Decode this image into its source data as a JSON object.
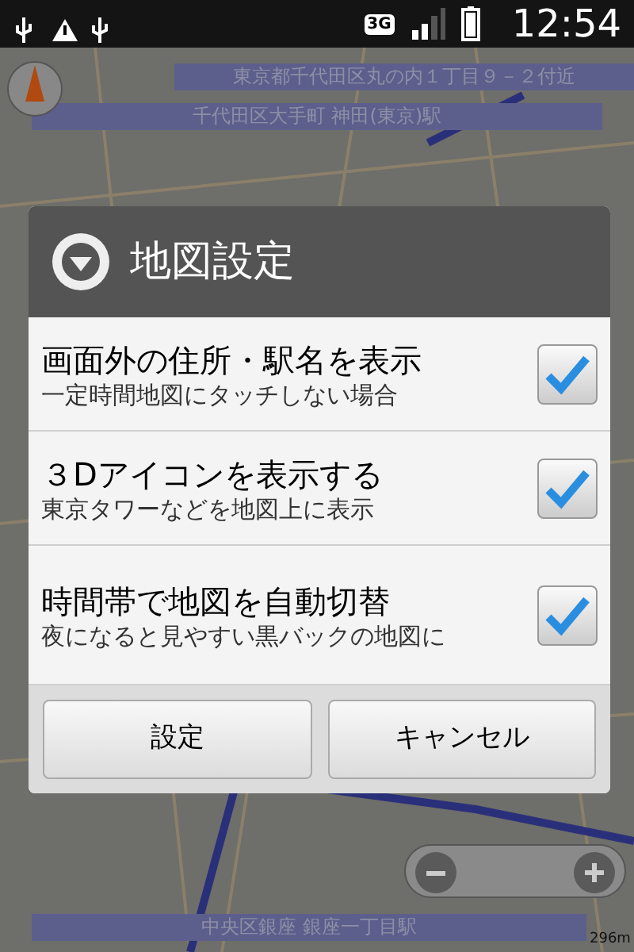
{
  "status_bar": {
    "network": "3G",
    "time": "12:54"
  },
  "map": {
    "banners": [
      {
        "text": "東京都千代田区丸の内１丁目９－２付近"
      },
      {
        "text": "千代田区大手町 神田(東京)駅"
      },
      {
        "text": "中央区銀座 銀座一丁目駅"
      }
    ],
    "scale": "296m"
  },
  "dialog": {
    "title": "地図設定",
    "items": [
      {
        "label": "画面外の住所・駅名を表示",
        "summary": "一定時間地図にタッチしない場合",
        "checked": true
      },
      {
        "label": "３Dアイコンを表示する",
        "summary": "東京タワーなどを地図上に表示",
        "checked": true
      },
      {
        "label": "時間帯で地図を自動切替",
        "summary": "夜になると見やすい黒バックの地図に",
        "checked": true
      }
    ],
    "buttons": [
      "設定",
      "キャンセル"
    ]
  }
}
